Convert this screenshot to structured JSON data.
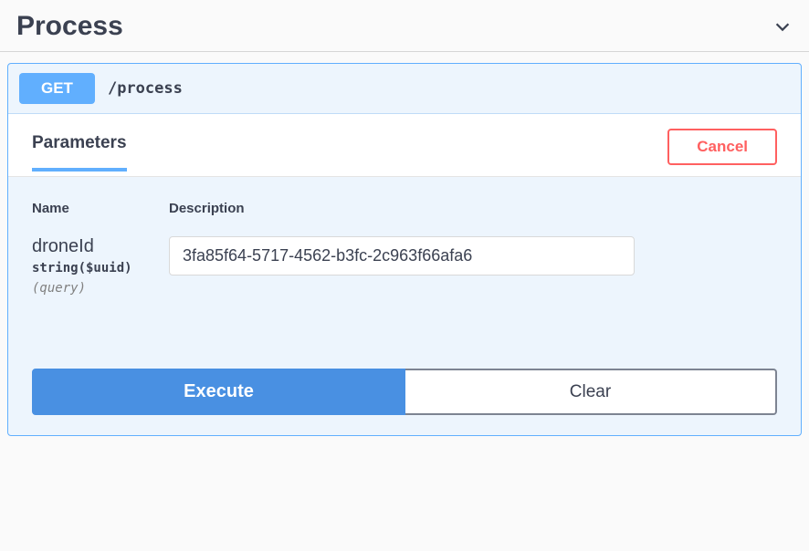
{
  "section": {
    "title": "Process"
  },
  "operation": {
    "method": "GET",
    "path": "/process"
  },
  "tabs": {
    "parameters": "Parameters",
    "cancel": "Cancel"
  },
  "columns": {
    "name": "Name",
    "description": "Description"
  },
  "param": {
    "name": "droneId",
    "type": "string($uuid)",
    "in": "(query)",
    "value": "3fa85f64-5717-4562-b3fc-2c963f66afa6"
  },
  "buttons": {
    "execute": "Execute",
    "clear": "Clear"
  }
}
